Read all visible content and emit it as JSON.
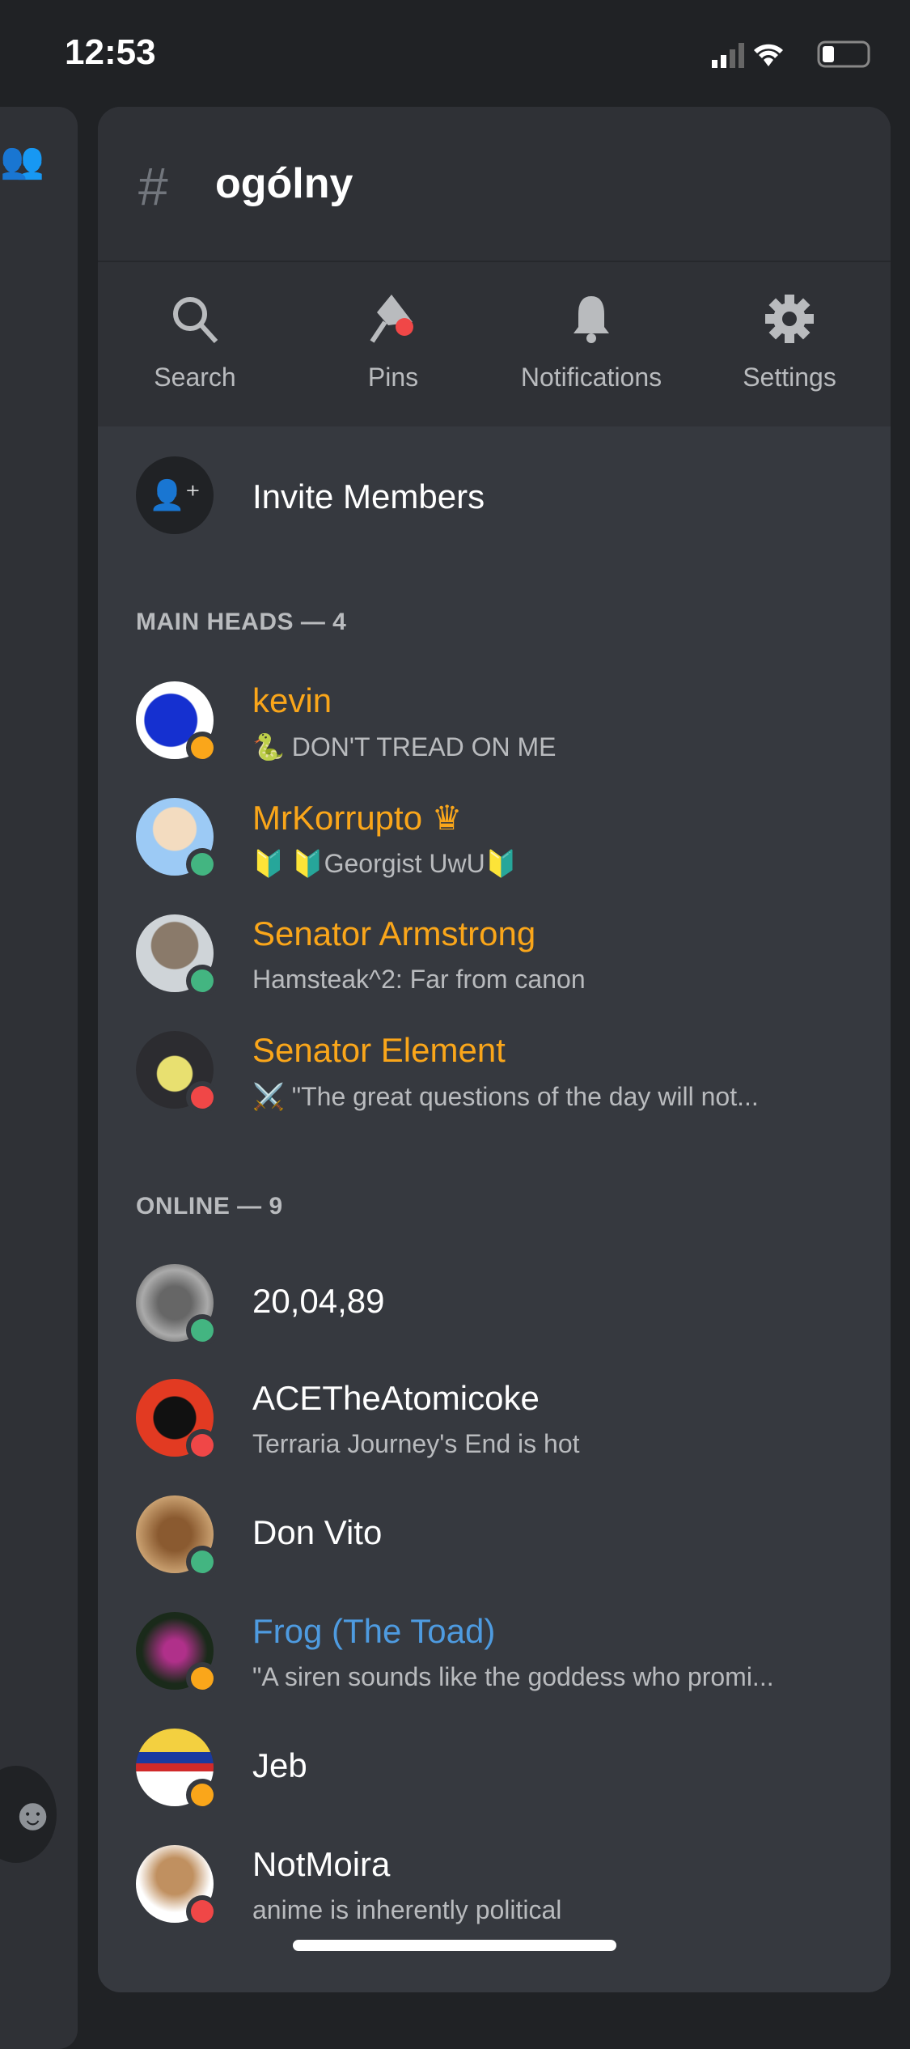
{
  "status_bar": {
    "time": "12:53"
  },
  "channel": {
    "title": "ogólny"
  },
  "toolbar": [
    {
      "label": "Search",
      "icon": "search-icon"
    },
    {
      "label": "Pins",
      "icon": "pin-icon"
    },
    {
      "label": "Notifications",
      "icon": "bell-icon"
    },
    {
      "label": "Settings",
      "icon": "gear-icon"
    }
  ],
  "invite": {
    "label": "Invite Members"
  },
  "sections": [
    {
      "header": "MAIN HEADS — 4",
      "members": [
        {
          "name": "kevin",
          "status": "🐍 DON'T TREAD ON ME",
          "presence": "idle",
          "color": "#faa61a"
        },
        {
          "name": "MrKorrupto",
          "crown": "♛",
          "status": "🔰 🔰Georgist UwU🔰",
          "presence": "online",
          "color": "#faa61a"
        },
        {
          "name": "Senator Armstrong",
          "status": "Hamsteak^2: Far from canon",
          "presence": "online",
          "color": "#faa61a"
        },
        {
          "name": "Senator Element",
          "status": "⚔️ \"The great questions of the day will not...",
          "presence": "dnd",
          "color": "#faa61a"
        }
      ]
    },
    {
      "header": "ONLINE — 9",
      "members": [
        {
          "name": "20,04,89",
          "status": "",
          "presence": "online",
          "color": "#ffffff"
        },
        {
          "name": "ACETheAtomicoke",
          "status": "Terraria Journey's End is hot",
          "presence": "dnd",
          "color": "#ffffff"
        },
        {
          "name": "Don Vito",
          "status": "",
          "presence": "online",
          "color": "#ffffff"
        },
        {
          "name": "Frog (The Toad)",
          "status": "\"A siren sounds like the goddess who promi...",
          "presence": "idle",
          "color": "#4e9be0"
        },
        {
          "name": "Jeb",
          "status": "",
          "presence": "idle",
          "color": "#ffffff"
        },
        {
          "name": "NotMoira",
          "status": "anime is inherently political",
          "presence": "dnd",
          "color": "#ffffff"
        }
      ]
    }
  ],
  "colors": {
    "online": "#43b581",
    "idle": "#faa61a",
    "dnd": "#f04747"
  }
}
